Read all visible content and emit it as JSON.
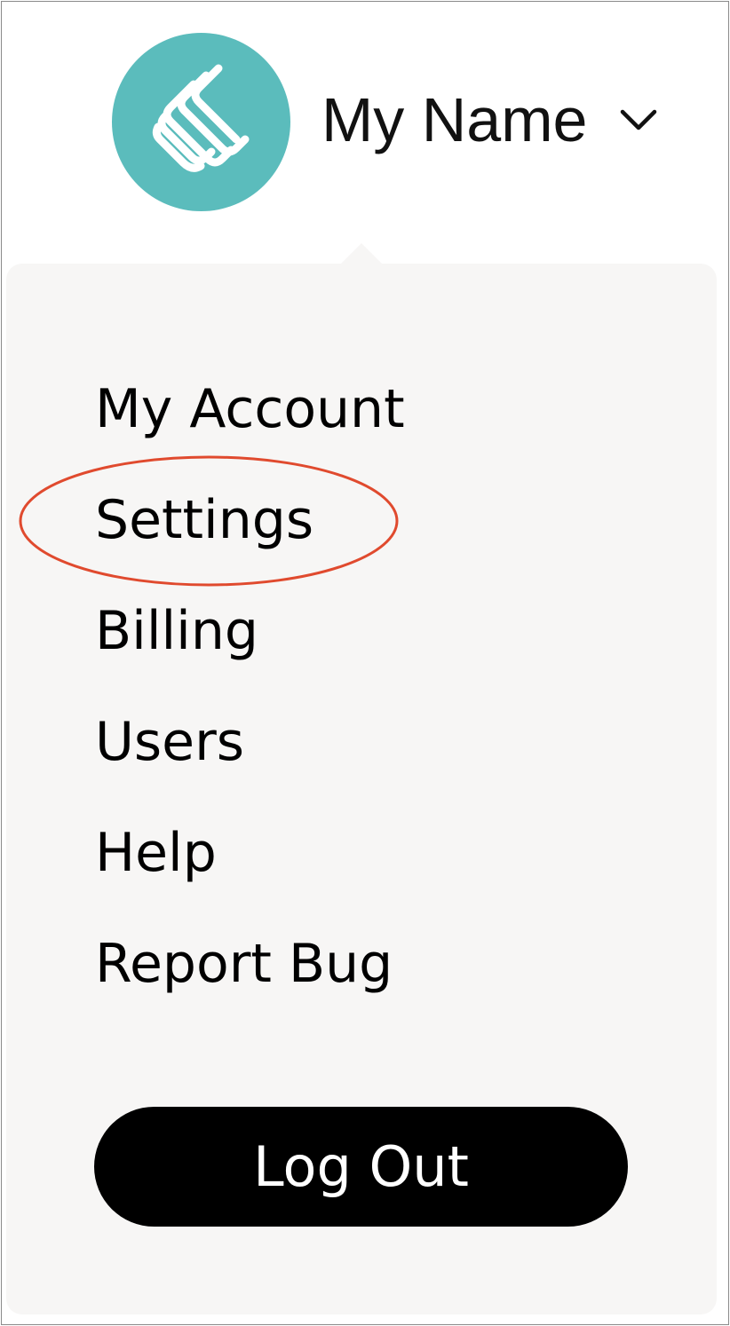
{
  "header": {
    "user_name": "My Name",
    "avatar_icon": "logo-stacked-s-icon",
    "dropdown_icon": "chevron-down-icon"
  },
  "menu": {
    "items": [
      {
        "label": "My Account"
      },
      {
        "label": "Settings"
      },
      {
        "label": "Billing"
      },
      {
        "label": "Users"
      },
      {
        "label": "Help"
      },
      {
        "label": "Report Bug"
      }
    ],
    "logout_label": "Log Out",
    "highlighted_item": "Settings"
  },
  "colors": {
    "avatar_bg": "#5bbcbc",
    "menu_bg": "#f7f6f5",
    "button_bg": "#000000",
    "button_text": "#ffffff",
    "annotation": "#e04a2e"
  }
}
